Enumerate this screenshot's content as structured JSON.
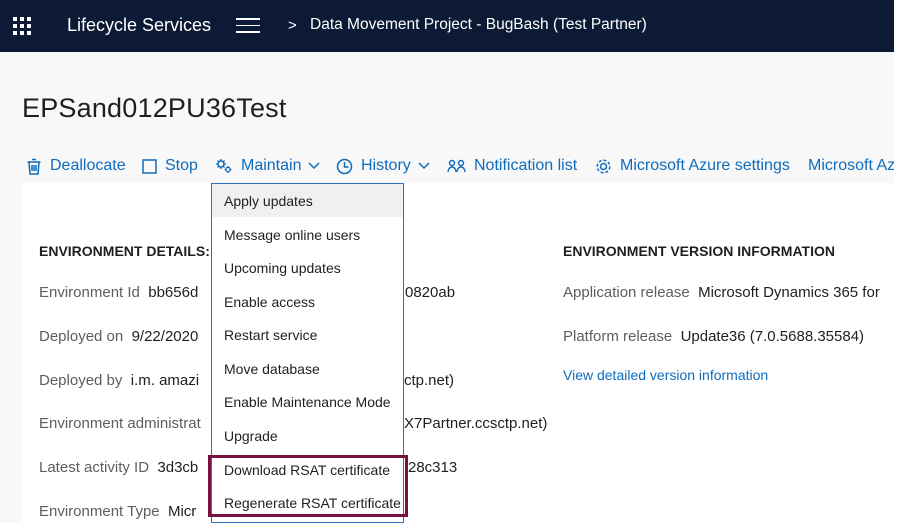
{
  "header": {
    "app_title": "Lifecycle Services",
    "breadcrumb_sep": ">",
    "breadcrumb": "Data Movement Project - BugBash (Test Partner)"
  },
  "page": {
    "title": "EPSand012PU36Test"
  },
  "toolbar": {
    "deallocate": "Deallocate",
    "stop": "Stop",
    "maintain": "Maintain",
    "history": "History",
    "notification_list": "Notification list",
    "azure_settings": "Microsoft Azure settings",
    "azure_cut": "Microsoft Az"
  },
  "details": {
    "heading": "ENVIRONMENT DETAILS:",
    "environment_id": {
      "label": "Environment Id",
      "value_start": "bb656d",
      "value_end": "0820ab"
    },
    "deployed_on": {
      "label": "Deployed on",
      "value": "9/22/2020"
    },
    "deployed_by": {
      "label": "Deployed by",
      "value_start": "i.m. amazi",
      "value_end": "ctp.net)"
    },
    "env_admin": {
      "label": "Environment administrat",
      "value_end": "X7Partner.ccsctp.net)"
    },
    "latest_activity": {
      "label": "Latest activity ID",
      "value_start": "3d3cb",
      "value_end": "28c313"
    },
    "env_type": {
      "label": "Environment Type",
      "value_start": "Micr"
    }
  },
  "version": {
    "heading": "ENVIRONMENT VERSION INFORMATION",
    "app_release": {
      "label": "Application release",
      "value": "Microsoft Dynamics 365 for"
    },
    "platform_release": {
      "label": "Platform release",
      "value": "Update36 (7.0.5688.35584)"
    },
    "view_link": "View detailed version information"
  },
  "maintain_menu": {
    "items": [
      "Apply updates",
      "Message online users",
      "Upcoming updates",
      "Enable access",
      "Restart service",
      "Move database",
      "Enable Maintenance Mode",
      "Upgrade",
      "Download RSAT certificate",
      "Regenerate RSAT certificate"
    ]
  },
  "colors": {
    "topbar": "#0c1a35",
    "link": "#0f6cbd",
    "highlight": "#7a1040",
    "menu_border": "#2f6fbe"
  }
}
